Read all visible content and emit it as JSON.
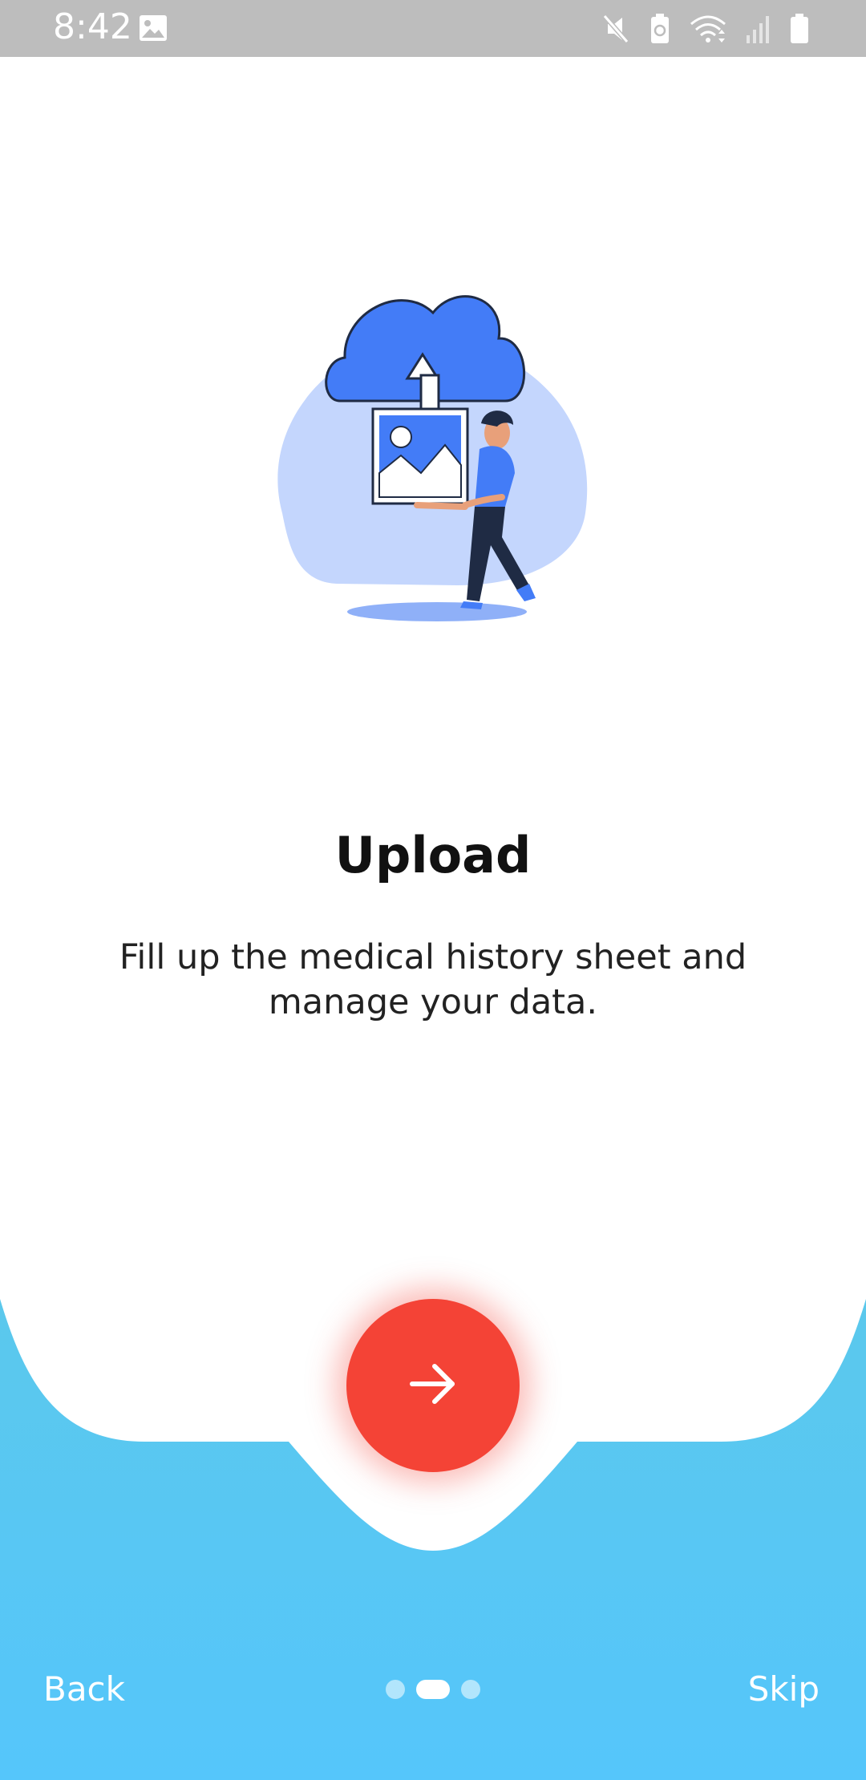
{
  "status_bar": {
    "time": "8:42",
    "icons": [
      "gallery-icon",
      "mute-icon",
      "battery-saver-icon",
      "wifi-icon",
      "signal-icon",
      "battery-icon"
    ]
  },
  "onboarding": {
    "illustration": "person-uploading-photo-to-cloud",
    "title": "Upload",
    "description": "Fill up the medical history sheet and manage your data."
  },
  "navigation": {
    "next_icon": "arrow-right-icon",
    "back_label": "Back",
    "skip_label": "Skip",
    "pager": {
      "total": 3,
      "current": 2
    }
  },
  "colors": {
    "accent": "#f44336",
    "bottom_gradient_top": "#5bc8ec",
    "bottom_gradient_bottom": "#55c6fb",
    "illustration_blue": "#437cf7",
    "illustration_light": "#c4d6fd"
  }
}
